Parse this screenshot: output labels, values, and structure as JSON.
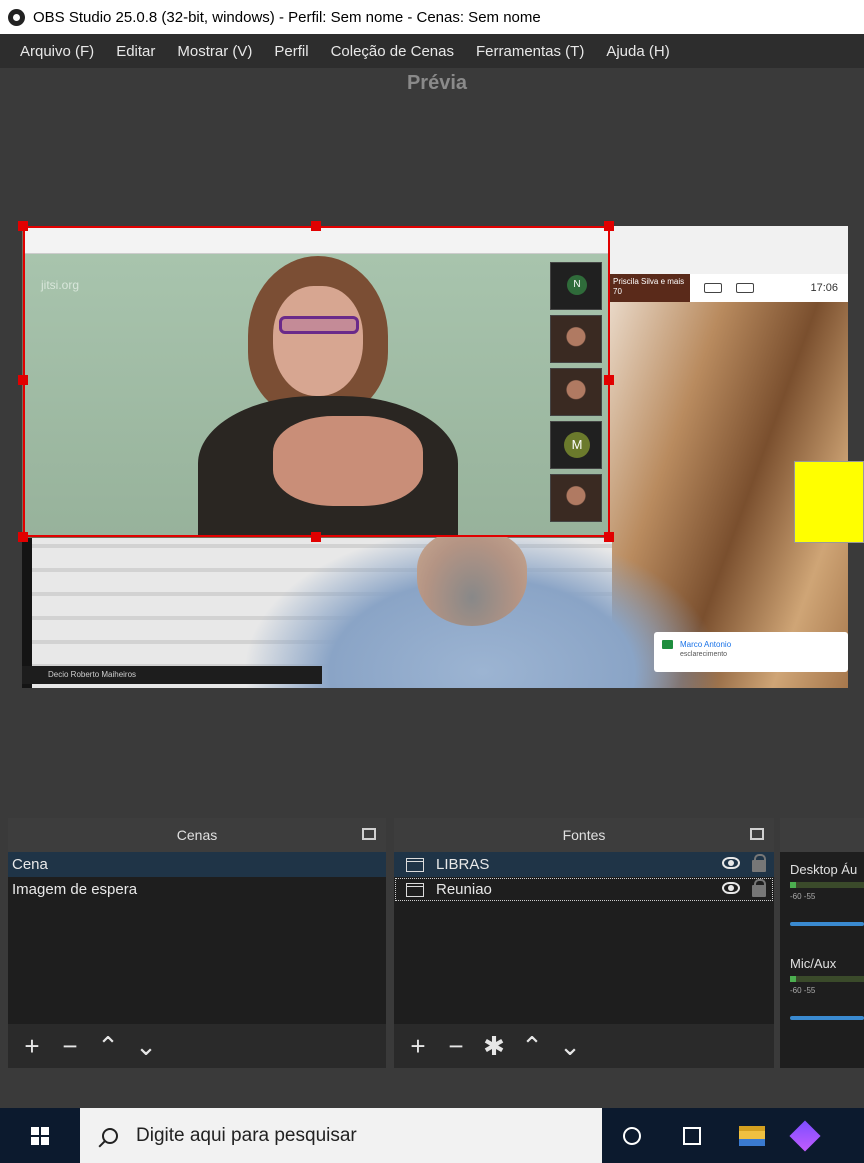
{
  "window": {
    "title": "OBS Studio 25.0.8 (32-bit, windows) - Perfil: Sem nome - Cenas: Sem nome"
  },
  "menu": [
    "Arquivo (F)",
    "Editar",
    "Mostrar (V)",
    "Perfil",
    "Coleção de Cenas",
    "Ferramentas (T)",
    "Ajuda (H)"
  ],
  "preview": {
    "label": "Prévia",
    "libras": {
      "site": "jitsi.org",
      "thumbs": [
        {
          "initial": "N"
        },
        {
          "initial": ""
        },
        {
          "initial": ""
        },
        {
          "initial": "M"
        },
        {
          "initial": ""
        }
      ]
    },
    "reuniao": {
      "participants": "Priscila Silva e mais 70",
      "time": "17:06",
      "name_tag": "Decio Roberto Maiheiros",
      "chat_name": "Marco Antonio",
      "chat_text": "esclarecimento"
    }
  },
  "scenes": {
    "header": "Cenas",
    "items": [
      "Cena",
      "Imagem de espera"
    ]
  },
  "sources": {
    "header": "Fontes",
    "items": [
      "LIBRAS",
      "Reuniao"
    ]
  },
  "mixer": {
    "channels": [
      {
        "name": "Desktop Áu",
        "scale": "-60        -55"
      },
      {
        "name": "Mic/Aux",
        "scale": "-60        -55"
      }
    ]
  },
  "taskbar": {
    "search_placeholder": "Digite aqui para pesquisar"
  },
  "colors": {
    "selection": "#e10000",
    "accent": "#3a8ad0",
    "highlight": "#ffff00"
  }
}
